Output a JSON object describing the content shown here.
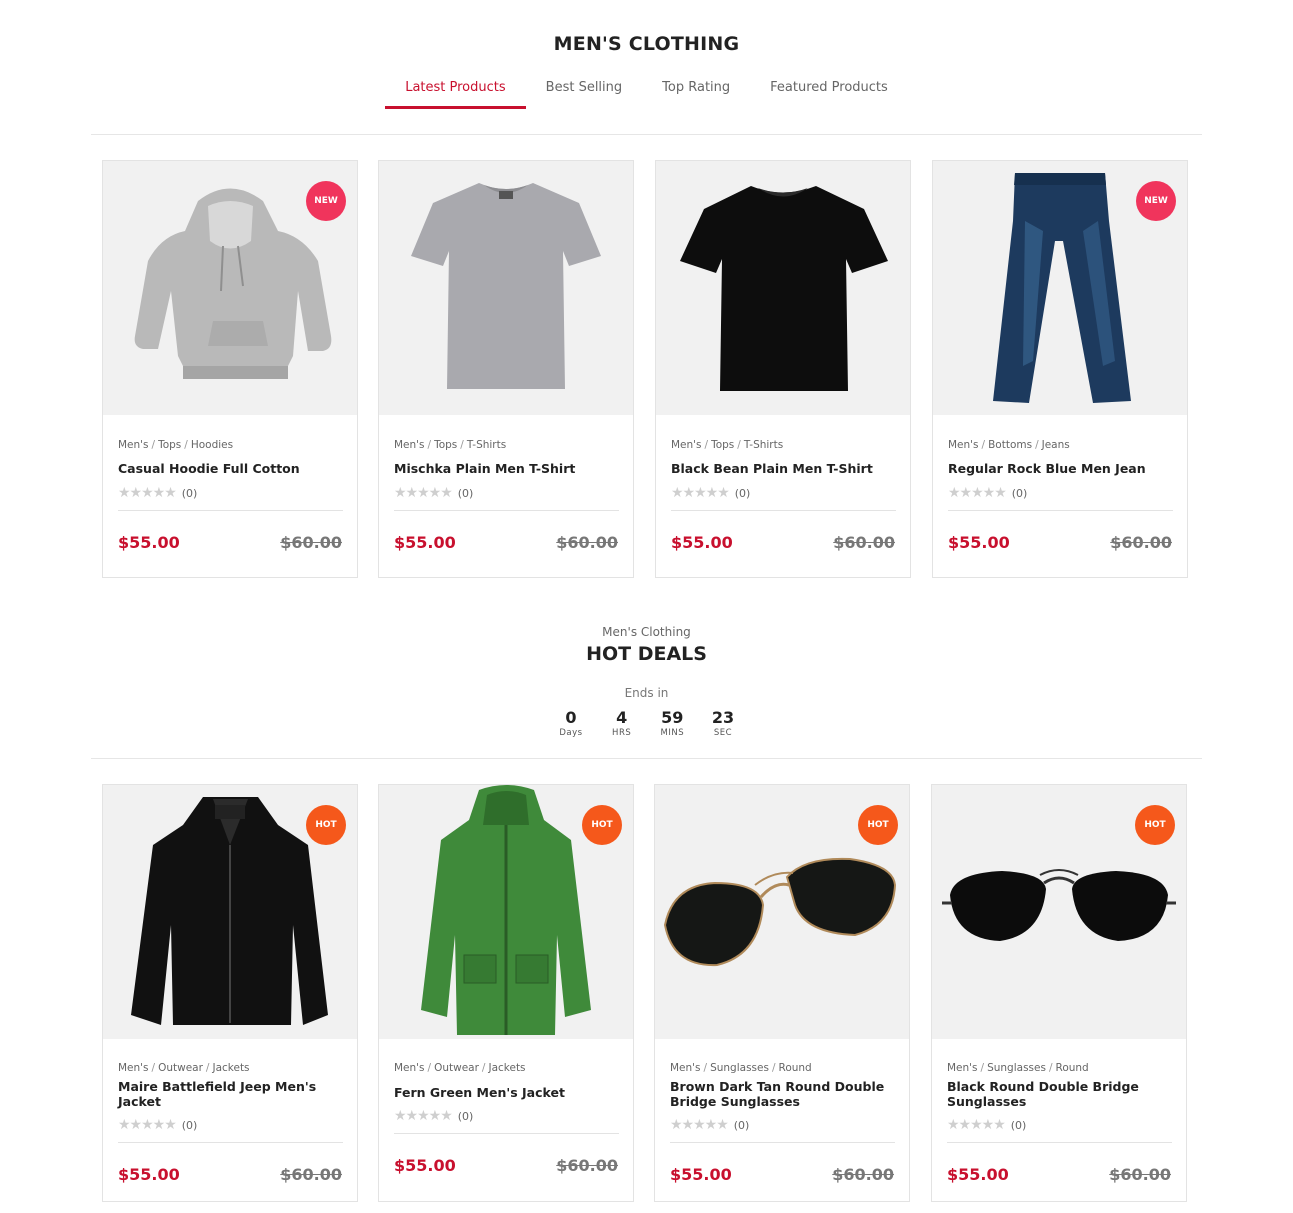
{
  "section1": {
    "title": "MEN'S CLOTHING",
    "tabs": [
      {
        "label": "Latest Products",
        "active": true
      },
      {
        "label": "Best Selling",
        "active": false
      },
      {
        "label": "Top Rating",
        "active": false
      },
      {
        "label": "Featured Products",
        "active": false
      }
    ],
    "products": [
      {
        "crumbs": [
          "Men's",
          "Tops",
          "Hoodies"
        ],
        "name": "Casual Hoodie Full Cotton",
        "rating_count": "(0)",
        "price": "$55.00",
        "old_price": "$60.00",
        "badge": "NEW",
        "image_icon": "hoodie-icon"
      },
      {
        "crumbs": [
          "Men's",
          "Tops",
          "T-Shirts"
        ],
        "name": "Mischka Plain Men T-Shirt",
        "rating_count": "(0)",
        "price": "$55.00",
        "old_price": "$60.00",
        "badge": "",
        "image_icon": "tshirt-icon"
      },
      {
        "crumbs": [
          "Men's",
          "Tops",
          "T-Shirts"
        ],
        "name": "Black Bean Plain Men T-Shirt",
        "rating_count": "(0)",
        "price": "$55.00",
        "old_price": "$60.00",
        "badge": "",
        "image_icon": "tshirt-icon"
      },
      {
        "crumbs": [
          "Men's",
          "Bottoms",
          "Jeans"
        ],
        "name": "Regular Rock Blue Men Jean",
        "rating_count": "(0)",
        "price": "$55.00",
        "old_price": "$60.00",
        "badge": "NEW",
        "image_icon": "jeans-icon"
      }
    ]
  },
  "section2": {
    "subtitle": "Men's Clothing",
    "title": "HOT DEALS",
    "ends_in": "Ends in",
    "countdown": [
      {
        "value": "0",
        "label": "Days"
      },
      {
        "value": "4",
        "label": "HRS"
      },
      {
        "value": "59",
        "label": "MINS"
      },
      {
        "value": "23",
        "label": "SEC"
      }
    ],
    "products": [
      {
        "crumbs": [
          "Men's",
          "Outwear",
          "Jackets"
        ],
        "name": "Maire Battlefield Jeep Men's Jacket",
        "rating_count": "(0)",
        "price": "$55.00",
        "old_price": "$60.00",
        "badge": "HOT",
        "image_icon": "leather-jacket-icon"
      },
      {
        "crumbs": [
          "Men's",
          "Outwear",
          "Jackets"
        ],
        "name": "Fern Green Men's Jacket",
        "rating_count": "(0)",
        "price": "$55.00",
        "old_price": "$60.00",
        "badge": "HOT",
        "image_icon": "parka-icon"
      },
      {
        "crumbs": [
          "Men's",
          "Sunglasses",
          "Round"
        ],
        "name": "Brown Dark Tan Round Double Bridge Sunglasses",
        "rating_count": "(0)",
        "price": "$55.00",
        "old_price": "$60.00",
        "badge": "HOT",
        "image_icon": "sunglasses-icon"
      },
      {
        "crumbs": [
          "Men's",
          "Sunglasses",
          "Round"
        ],
        "name": "Black Round Double Bridge Sunglasses",
        "rating_count": "(0)",
        "price": "$55.00",
        "old_price": "$60.00",
        "badge": "HOT",
        "image_icon": "sunglasses-icon"
      }
    ]
  },
  "colors": {
    "accent": "#c8102e",
    "badge_new": "#f0345c",
    "badge_hot": "#f5581b",
    "image_bg": "#f1f1f1",
    "star": "#cfcfcf"
  }
}
